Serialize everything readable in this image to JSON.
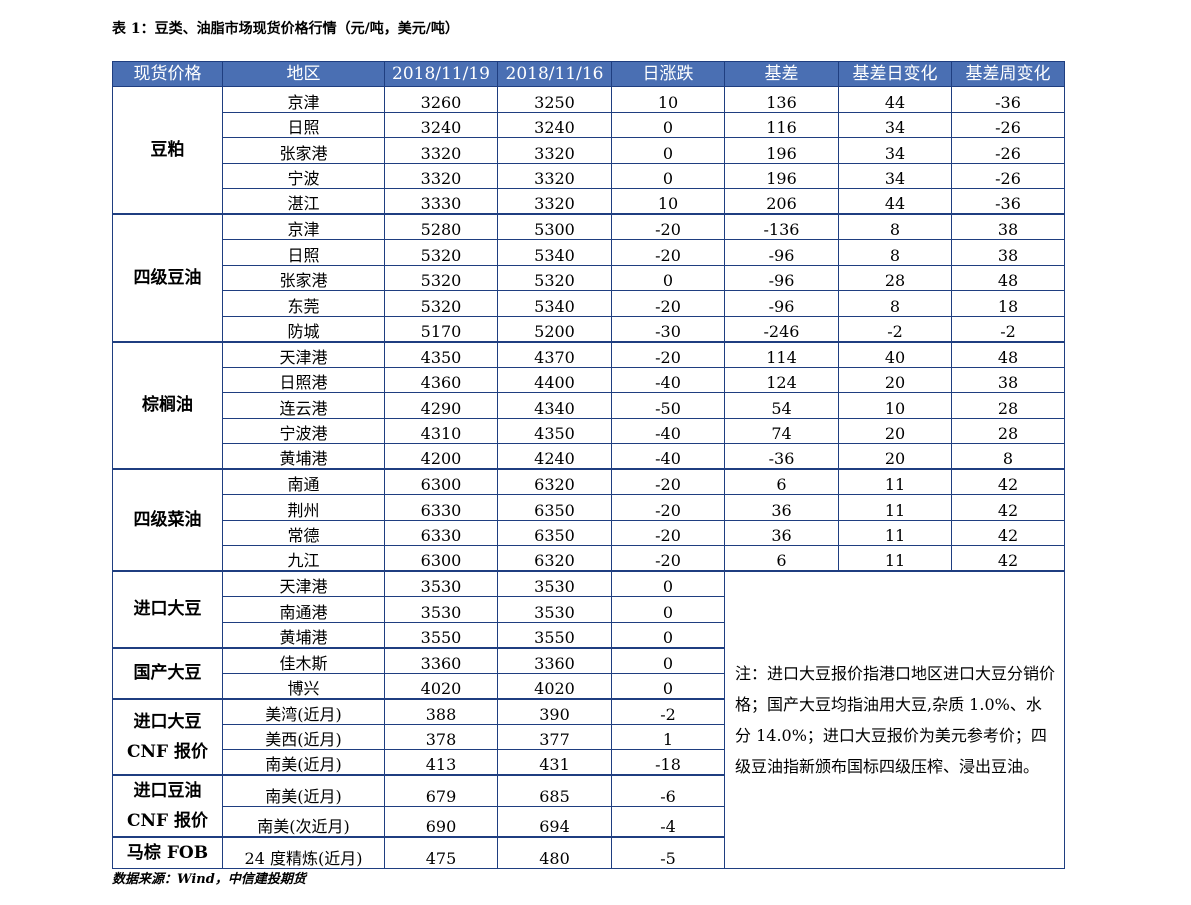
{
  "title": "表 1：豆类、油脂市场现货价格行情（元/吨，美元/吨）",
  "headers": [
    "现货价格",
    "地区",
    "2018/11/19",
    "2018/11/16",
    "日涨跌",
    "基差",
    "基差日变化",
    "基差周变化"
  ],
  "groups_full": [
    {
      "name": "豆粕",
      "rows": [
        [
          "京津",
          "3260",
          "3250",
          "10",
          "136",
          "44",
          "-36"
        ],
        [
          "日照",
          "3240",
          "3240",
          "0",
          "116",
          "34",
          "-26"
        ],
        [
          "张家港",
          "3320",
          "3320",
          "0",
          "196",
          "34",
          "-26"
        ],
        [
          "宁波",
          "3320",
          "3320",
          "0",
          "196",
          "34",
          "-26"
        ],
        [
          "湛江",
          "3330",
          "3320",
          "10",
          "206",
          "44",
          "-36"
        ]
      ]
    },
    {
      "name": "四级豆油",
      "rows": [
        [
          "京津",
          "5280",
          "5300",
          "-20",
          "-136",
          "8",
          "38"
        ],
        [
          "日照",
          "5320",
          "5340",
          "-20",
          "-96",
          "8",
          "38"
        ],
        [
          "张家港",
          "5320",
          "5320",
          "0",
          "-96",
          "28",
          "48"
        ],
        [
          "东莞",
          "5320",
          "5340",
          "-20",
          "-96",
          "8",
          "18"
        ],
        [
          "防城",
          "5170",
          "5200",
          "-30",
          "-246",
          "-2",
          "-2"
        ]
      ]
    },
    {
      "name": "棕榈油",
      "rows": [
        [
          "天津港",
          "4350",
          "4370",
          "-20",
          "114",
          "40",
          "48"
        ],
        [
          "日照港",
          "4360",
          "4400",
          "-40",
          "124",
          "20",
          "38"
        ],
        [
          "连云港",
          "4290",
          "4340",
          "-50",
          "54",
          "10",
          "28"
        ],
        [
          "宁波港",
          "4310",
          "4350",
          "-40",
          "74",
          "20",
          "28"
        ],
        [
          "黄埔港",
          "4200",
          "4240",
          "-40",
          "-36",
          "20",
          "8"
        ]
      ]
    },
    {
      "name": "四级菜油",
      "rows": [
        [
          "南通",
          "6300",
          "6320",
          "-20",
          "6",
          "11",
          "42"
        ],
        [
          "荆州",
          "6330",
          "6350",
          "-20",
          "36",
          "11",
          "42"
        ],
        [
          "常德",
          "6330",
          "6350",
          "-20",
          "36",
          "11",
          "42"
        ],
        [
          "九江",
          "6300",
          "6320",
          "-20",
          "6",
          "11",
          "42"
        ]
      ]
    }
  ],
  "groups_partial": [
    {
      "name_lines": [
        "进口大豆"
      ],
      "rows": [
        [
          "天津港",
          "3530",
          "3530",
          "0"
        ],
        [
          "南通港",
          "3530",
          "3530",
          "0"
        ],
        [
          "黄埔港",
          "3550",
          "3550",
          "0"
        ]
      ]
    },
    {
      "name_lines": [
        "国产大豆"
      ],
      "rows": [
        [
          "佳木斯",
          "3360",
          "3360",
          "0"
        ],
        [
          "博兴",
          "4020",
          "4020",
          "0"
        ]
      ]
    },
    {
      "name_lines": [
        "进口大豆",
        "CNF 报价"
      ],
      "rows": [
        [
          "美湾(近月)",
          "388",
          "390",
          "-2"
        ],
        [
          "美西(近月)",
          "378",
          "377",
          "1"
        ],
        [
          "南美(近月)",
          "413",
          "431",
          "-18"
        ]
      ]
    },
    {
      "name_lines": [
        "进口豆油",
        "CNF 报价"
      ],
      "rows": [
        [
          "南美(近月)",
          "679",
          "685",
          "-6"
        ],
        [
          "南美(次近月)",
          "690",
          "694",
          "-4"
        ]
      ]
    },
    {
      "name_lines": [
        "马棕 FOB"
      ],
      "rows": [
        [
          "24 度精炼(近月)",
          "475",
          "480",
          "-5"
        ]
      ]
    }
  ],
  "note": "注：进口大豆报价指港口地区进口大豆分销价格；国产大豆均指油用大豆,杂质 1.0%、水分 14.0%；进口大豆报价为美元参考价；四级豆油指新颁布国标四级压榨、浸出豆油。",
  "source": "数据来源：Wind，中信建投期货"
}
